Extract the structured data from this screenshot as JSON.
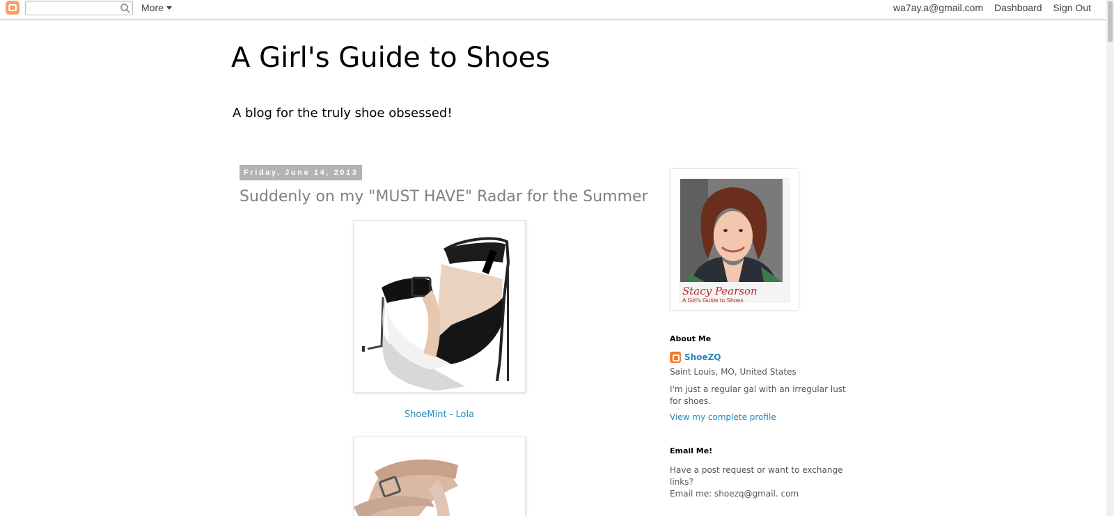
{
  "navbar": {
    "search_placeholder": "",
    "more_label": "More",
    "account_email": "wa7ay.a@gmail.com",
    "dashboard_label": "Dashboard",
    "signout_label": "Sign Out"
  },
  "header": {
    "title": "A Girl's Guide to Shoes",
    "description": "A blog for the truly shoe obsessed!"
  },
  "post": {
    "date": "Friday, June 14, 2013",
    "title": "Suddenly on my \"MUST HAVE\" Radar for the Summer",
    "image1_caption": "ShoeMint - Lola"
  },
  "sidebar": {
    "photo_name": "Stacy Pearson",
    "photo_subtitle": "A Girl's Guide to Shoes",
    "about_heading": "About Me",
    "profile_name": "ShoeZQ",
    "location": "Saint Louis, MO, United States",
    "bio": "I'm just a regular gal with an irregular lust for shoes.",
    "profile_link": "View my complete profile",
    "email_heading": "Email Me!",
    "email_line1": "Have a post request or want to exchange links?",
    "email_line2": "Email me: shoezq@gmail. com"
  },
  "colors": {
    "link": "#2288bb",
    "post_title": "#808080",
    "date_bg": "#b3b3b3",
    "blogger_orange": "#f27b2a"
  }
}
